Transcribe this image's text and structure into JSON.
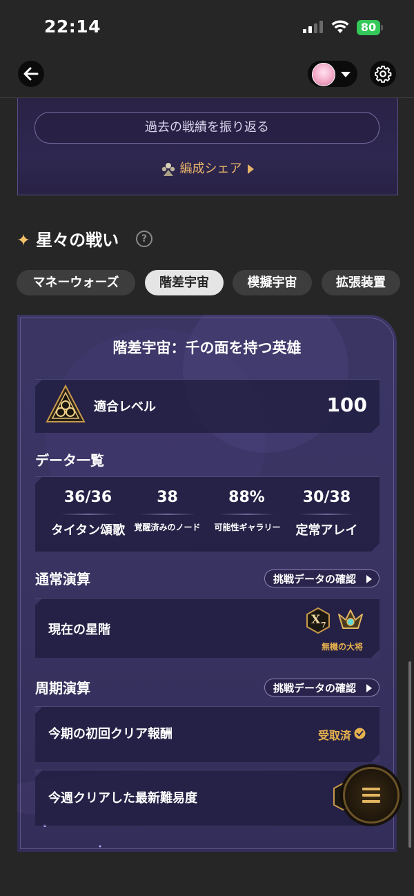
{
  "status_bar": {
    "time": "22:14",
    "battery": "80"
  },
  "top_card": {
    "review_button": "過去の戦績を振り返る",
    "share_link": "編成シェア"
  },
  "section": {
    "title": "星々の戦い",
    "help": "?"
  },
  "tabs": [
    {
      "label": "マネーウォーズ"
    },
    {
      "label": "階差宇宙"
    },
    {
      "label": "模擬宇宙"
    },
    {
      "label": "拡張装置"
    }
  ],
  "card": {
    "title": "階差宇宙：千の面を持つ英雄",
    "level_label": "適合レベル",
    "level_value": "100",
    "data_title": "データ一覧",
    "stats": [
      {
        "value": "36/36",
        "label": "タイタン頌歌"
      },
      {
        "value": "38",
        "label": "覚醒済みのノード"
      },
      {
        "value": "88%",
        "label": "可能性ギャラリー"
      },
      {
        "value": "30/38",
        "label": "定常アレイ"
      }
    ],
    "normal": {
      "title": "通常演算",
      "button": "挑戦データの確認",
      "row_label": "現在の星階",
      "rank_badge": "X",
      "rank_sub": "7",
      "rank_name": "無機の大将"
    },
    "periodic": {
      "title": "周期演算",
      "button": "挑戦データの確認",
      "reward_label": "今期の初回クリア報酬",
      "reward_status": "受取済",
      "difficulty_label": "今週クリアした最新難易度"
    }
  },
  "colors": {
    "accent_gold": "#e7b24d",
    "card_bg": "#3a3463",
    "battery_green": "#34c759"
  }
}
